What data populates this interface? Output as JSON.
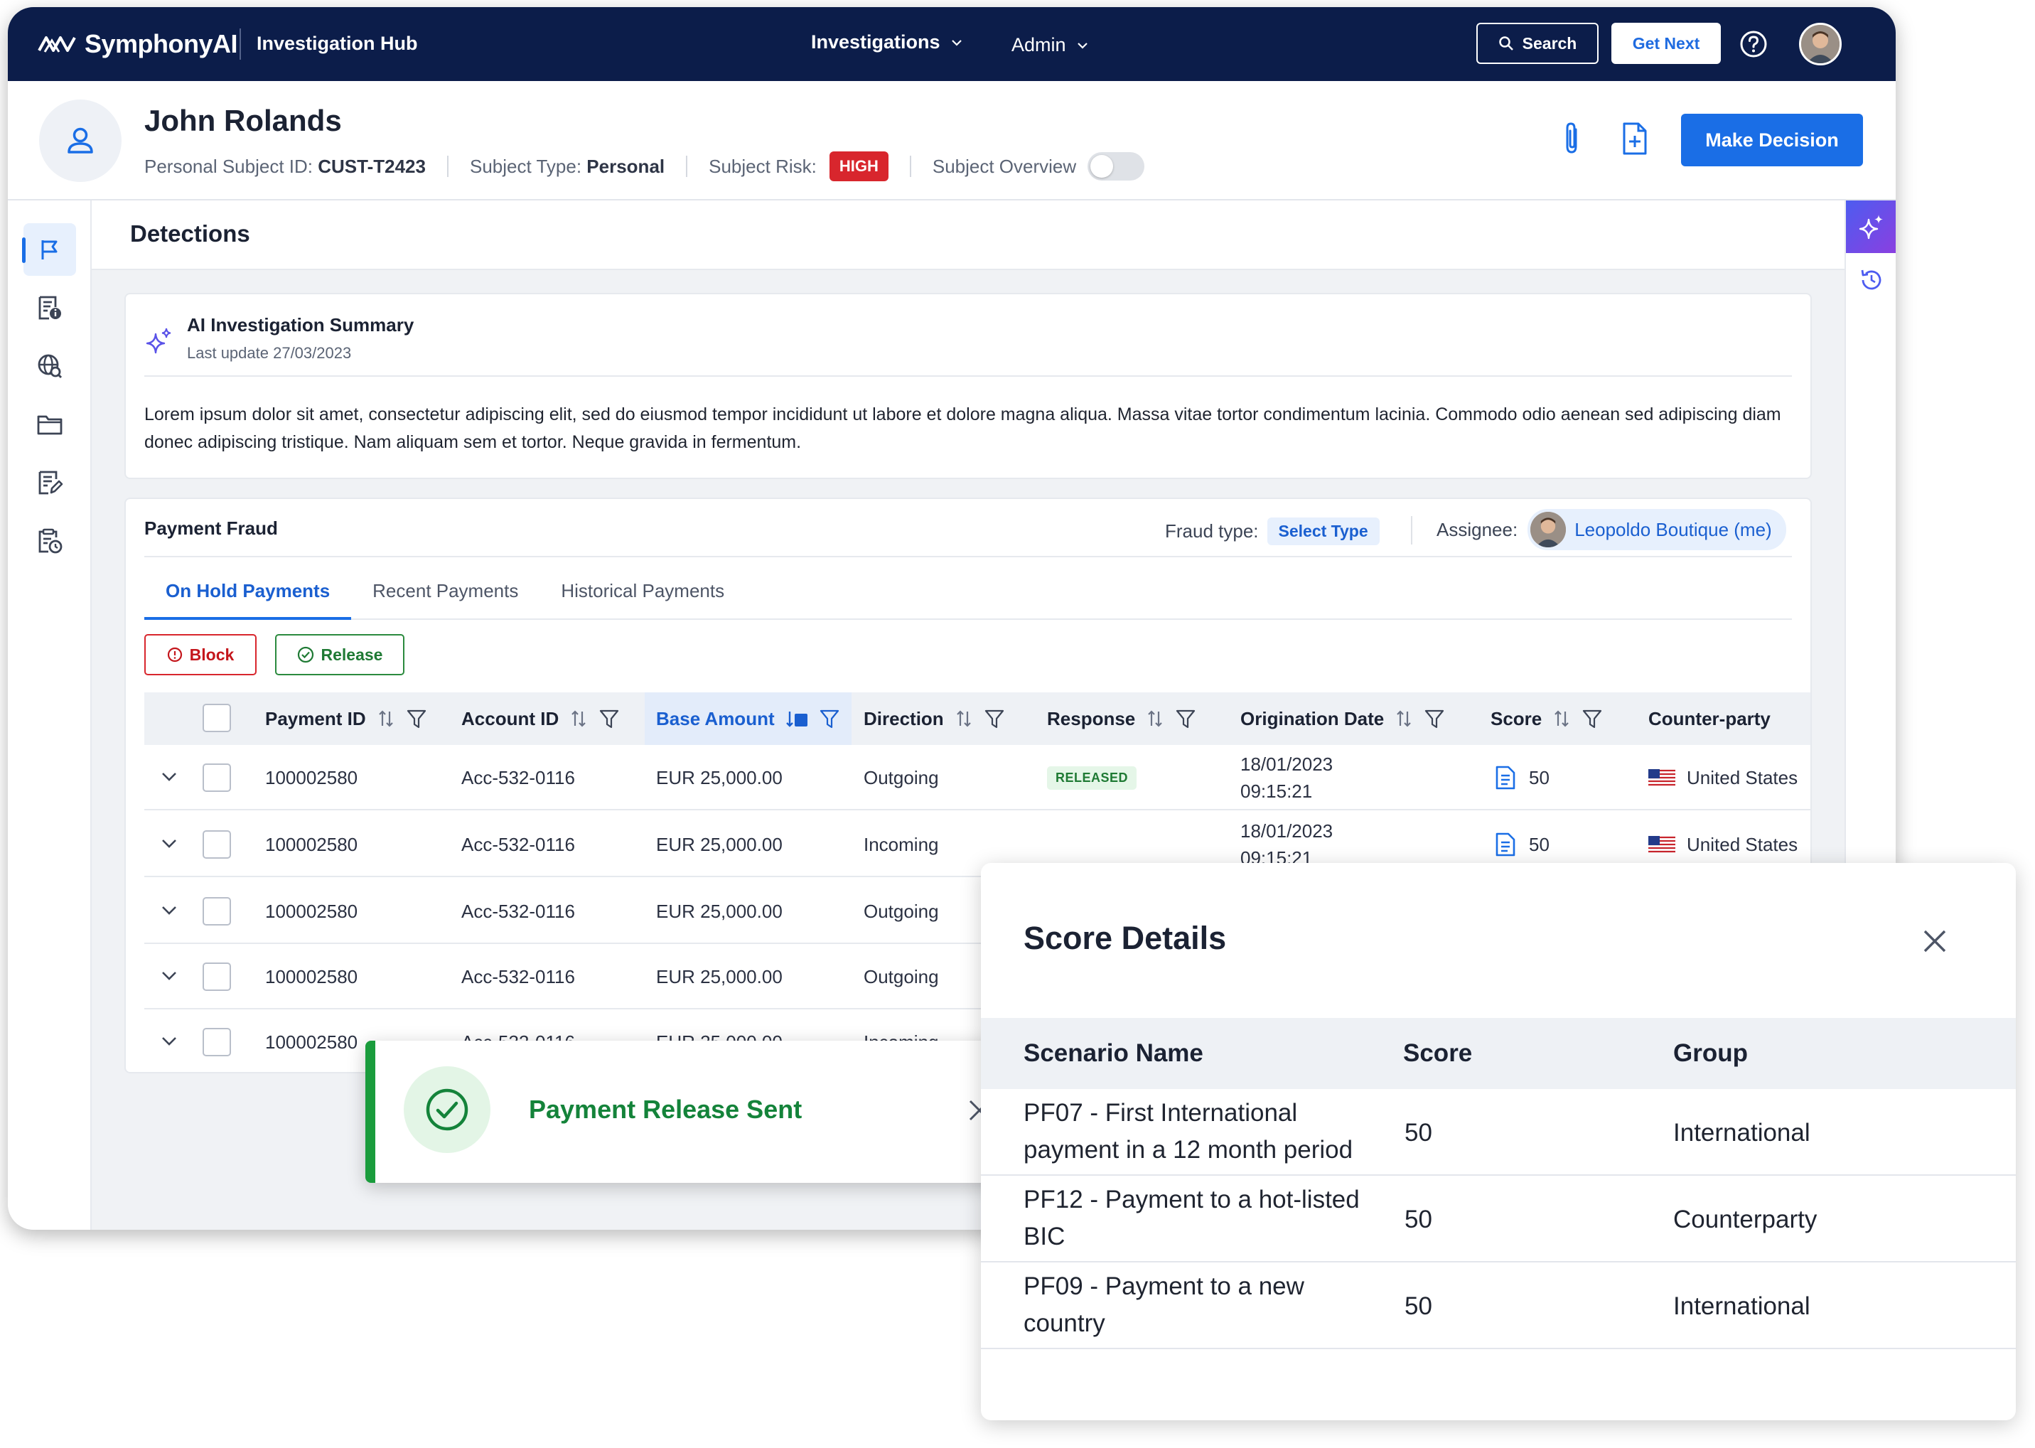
{
  "topbar": {
    "brand": "SymphonyAI",
    "app_name": "Investigation Hub",
    "menu": [
      "Investigations",
      "Admin"
    ],
    "search_label": "Search",
    "get_next_label": "Get Next"
  },
  "subject": {
    "name": "John Rolands",
    "id_label": "Personal Subject ID:",
    "id_value": "CUST-T2423",
    "type_label": "Subject Type:",
    "type_value": "Personal",
    "risk_label": "Subject Risk:",
    "risk_value": "HIGH",
    "overview_label": "Subject Overview",
    "make_decision": "Make Decision"
  },
  "main": {
    "title": "Detections"
  },
  "ai_summary": {
    "title": "AI Investigation Summary",
    "last_update": "Last update 27/03/2023",
    "text": "Lorem ipsum dolor sit amet, consectetur adipiscing elit, sed do eiusmod tempor incididunt ut labore et dolore magna aliqua. Massa vitae tortor condimentum lacinia. Commodo odio aenean sed adipiscing diam donec adipiscing tristique. Nam aliquam sem et tortor. Neque gravida in fermentum."
  },
  "payment": {
    "title": "Payment Fraud",
    "fraud_type_label": "Fraud type:",
    "fraud_type_value": "Select Type",
    "assignee_label": "Assignee:",
    "assignee_value": "Leopoldo Boutique (me)",
    "tabs": [
      "On Hold Payments",
      "Recent Payments",
      "Historical Payments"
    ],
    "block_label": "Block",
    "release_label": "Release",
    "columns": [
      "Payment ID",
      "Account ID",
      "Base Amount",
      "Direction",
      "Response",
      "Origination Date",
      "Score",
      "Counter-party"
    ],
    "sort_badge": "1",
    "rows": [
      {
        "payment_id": "100002580",
        "account_id": "Acc-532-0116",
        "amount": "EUR 25,000.00",
        "direction": "Outgoing",
        "response": "RELEASED",
        "date": "18/01/2023",
        "time": "09:15:21",
        "score": "50",
        "counterparty": "United States"
      },
      {
        "payment_id": "100002580",
        "account_id": "Acc-532-0116",
        "amount": "EUR 25,000.00",
        "direction": "Incoming",
        "response": "",
        "date": "18/01/2023",
        "time": "09:15:21",
        "score": "50",
        "counterparty": "United States"
      },
      {
        "payment_id": "100002580",
        "account_id": "Acc-532-0116",
        "amount": "EUR 25,000.00",
        "direction": "Outgoing"
      },
      {
        "payment_id": "100002580",
        "account_id": "Acc-532-0116",
        "amount": "EUR 25,000.00",
        "direction": "Outgoing"
      },
      {
        "payment_id": "100002580",
        "account_id": "Acc-532-0116",
        "amount": "EUR 25,000.00",
        "direction": "Incoming"
      }
    ]
  },
  "toast": {
    "message": "Payment Release Sent"
  },
  "score_details": {
    "title": "Score Details",
    "columns": [
      "Scenario Name",
      "Score",
      "Group"
    ],
    "rows": [
      {
        "name": "PF07 - First  International payment in a 12 month period",
        "score": "50",
        "group": "International"
      },
      {
        "name": "PF12 - Payment to a hot-listed BIC",
        "score": "50",
        "group": "Counterparty"
      },
      {
        "name": "PF09 - Payment to a new country",
        "score": "50",
        "group": "International"
      }
    ]
  },
  "colors": {
    "navbar": "#0c1d4a",
    "primary": "#1a6ee6",
    "risk_high": "#d8262d",
    "success": "#1a9c3c"
  }
}
